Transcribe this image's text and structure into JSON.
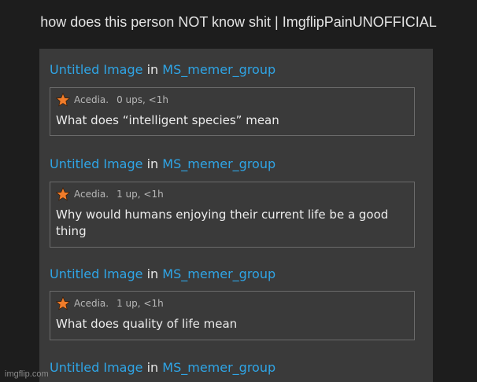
{
  "meme_title": "how does this person NOT know shit | ImgflipPainUNOFFICIAL",
  "watermark": "imgflip.com",
  "icons": {
    "user_badge": "star-icon",
    "badge_color": "#f07c2a"
  },
  "colors": {
    "link": "#2fa5e6",
    "panel_bg": "#3a3a3a",
    "page_bg": "#1d1d1d"
  },
  "entries": [
    {
      "image_link": "Untitled Image",
      "in_word": "in",
      "group_link": "MS_memer_group",
      "comment": {
        "username": "Acedia.",
        "meta": "0 ups, <1h",
        "text": "What does “intelligent species” mean"
      }
    },
    {
      "image_link": "Untitled Image",
      "in_word": "in",
      "group_link": "MS_memer_group",
      "comment": {
        "username": "Acedia.",
        "meta": "1 up, <1h",
        "text": "Why would humans enjoying their current life be a good thing"
      }
    },
    {
      "image_link": "Untitled Image",
      "in_word": "in",
      "group_link": "MS_memer_group",
      "comment": {
        "username": "Acedia.",
        "meta": "1 up, <1h",
        "text": "What does quality of life mean"
      }
    },
    {
      "image_link": "Untitled Image",
      "in_word": "in",
      "group_link": "MS_memer_group"
    }
  ]
}
